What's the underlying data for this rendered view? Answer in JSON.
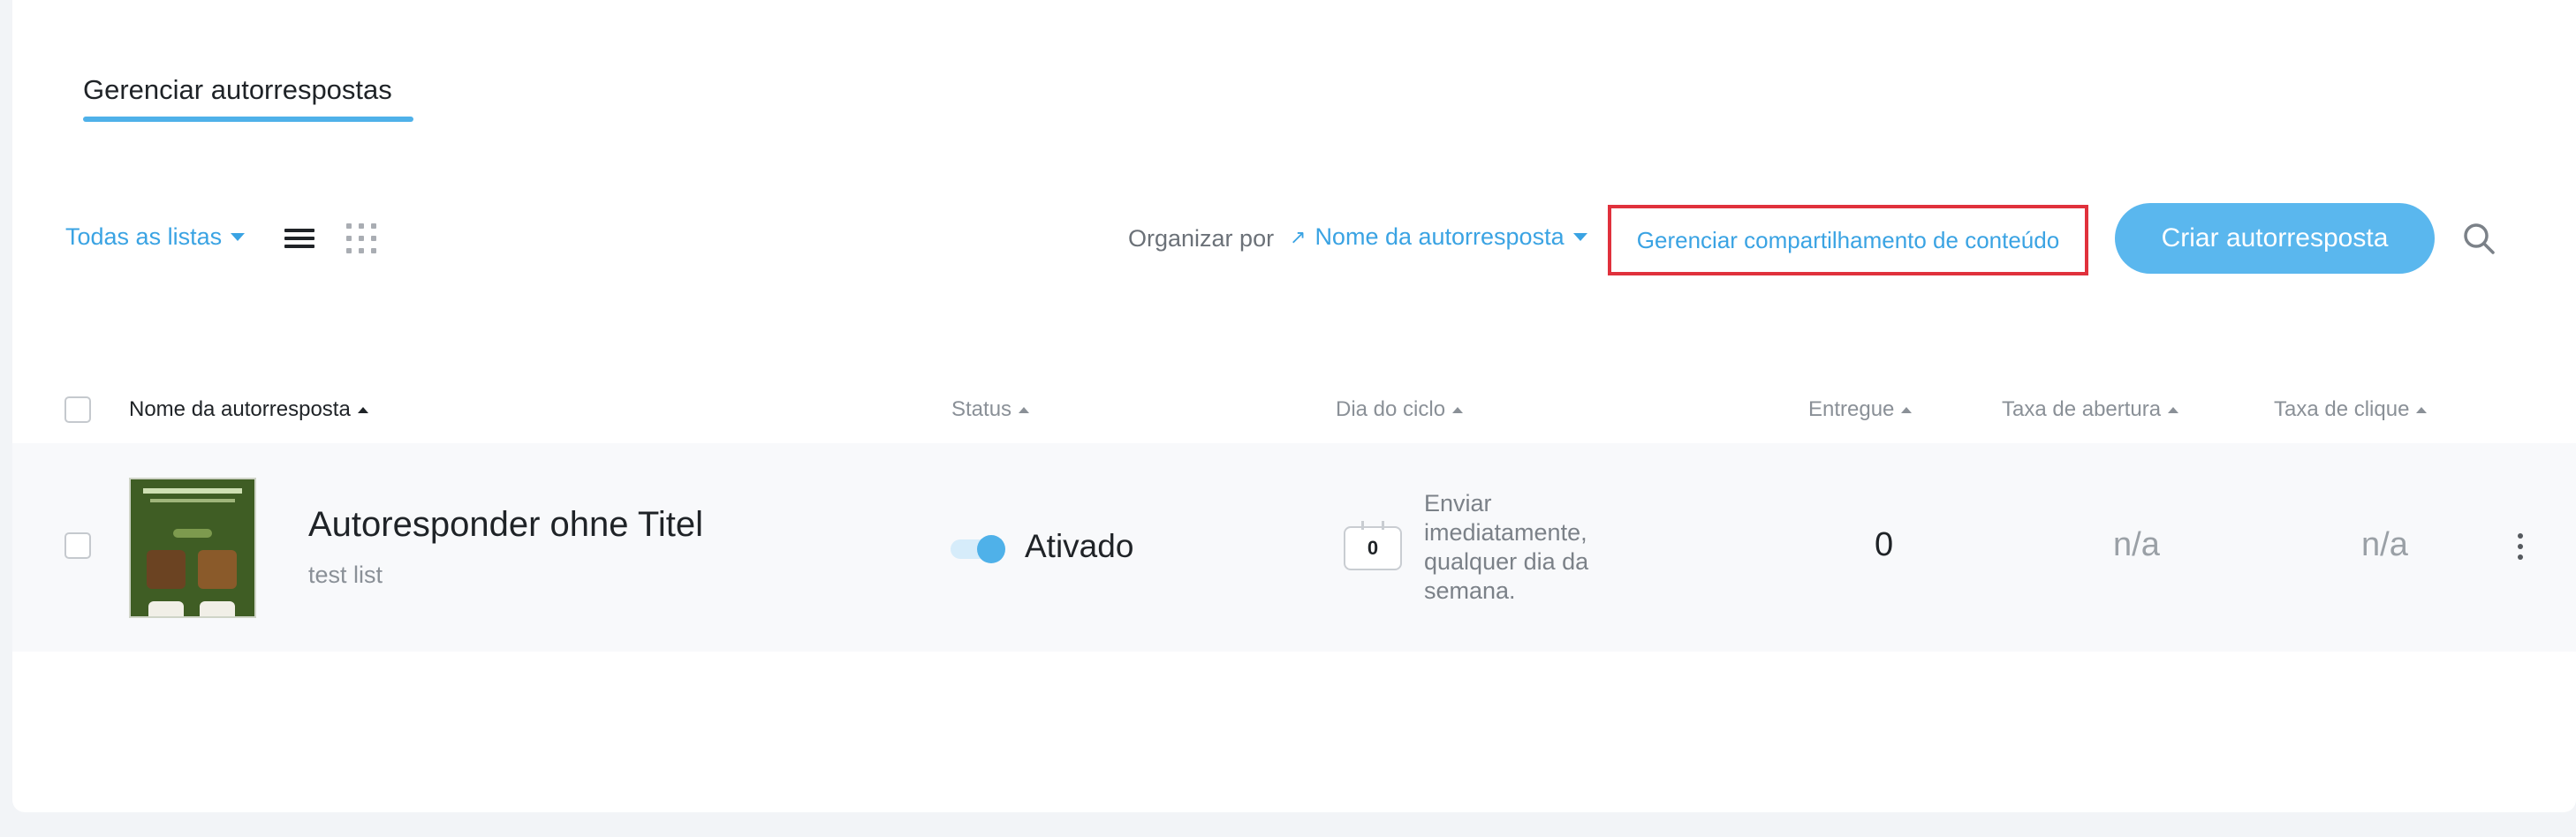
{
  "tabs": {
    "active_label": "Gerenciar autorrespostas"
  },
  "toolbar": {
    "lists_filter": "Todas as listas",
    "sort_label": "Organizar por",
    "sort_value": "Nome da autorresposta",
    "manage_share_label": "Gerenciar compartilhamento de conteúdo",
    "create_label": "Criar autorresposta"
  },
  "table": {
    "columns": {
      "name": "Nome da autorresposta",
      "status": "Status",
      "cycle_day": "Dia do ciclo",
      "delivered": "Entregue",
      "open_rate": "Taxa de abertura",
      "click_rate": "Taxa de clique"
    },
    "rows": [
      {
        "name": "Autoresponder ohne Titel",
        "list": "test list",
        "status": "Ativado",
        "status_on": true,
        "cycle_day": "0",
        "cycle_text": "Enviar imediatamente, qualquer dia da semana.",
        "delivered": "0",
        "open_rate": "n/a",
        "click_rate": "n/a"
      }
    ]
  },
  "colors": {
    "accent": "#3aa3e3",
    "primary_button": "#5ab7ee",
    "highlight_border": "#e0313c"
  }
}
